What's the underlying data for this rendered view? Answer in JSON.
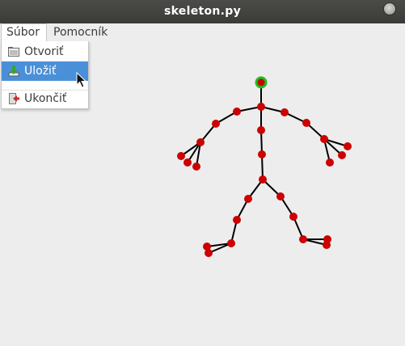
{
  "window": {
    "title": "skeleton.py"
  },
  "menubar": {
    "file_label": "Súbor",
    "help_label": "Pomocník"
  },
  "file_menu": {
    "items": [
      {
        "label": "Otvoriť",
        "icon": "folder-open-icon"
      },
      {
        "label": "Uložiť",
        "icon": "save-icon"
      },
      {
        "label": "Ukončiť",
        "icon": "quit-icon"
      }
    ],
    "highlighted": "Uložiť"
  },
  "colors": {
    "accent": "#4a90d9",
    "joint": "#cc0000",
    "selected_joint_ring": "#22bb22",
    "bone": "#000000"
  }
}
